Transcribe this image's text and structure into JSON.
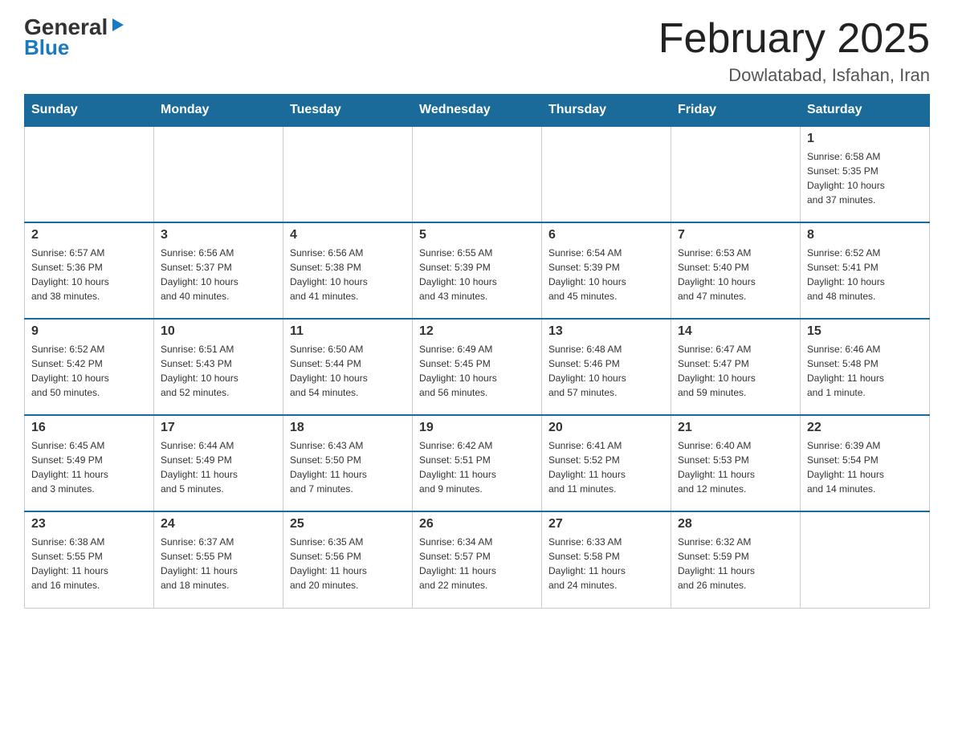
{
  "header": {
    "logo_general": "General",
    "logo_blue": "Blue",
    "month_title": "February 2025",
    "location": "Dowlatabad, Isfahan, Iran"
  },
  "days_of_week": [
    "Sunday",
    "Monday",
    "Tuesday",
    "Wednesday",
    "Thursday",
    "Friday",
    "Saturday"
  ],
  "weeks": [
    [
      {
        "day": "",
        "info": ""
      },
      {
        "day": "",
        "info": ""
      },
      {
        "day": "",
        "info": ""
      },
      {
        "day": "",
        "info": ""
      },
      {
        "day": "",
        "info": ""
      },
      {
        "day": "",
        "info": ""
      },
      {
        "day": "1",
        "info": "Sunrise: 6:58 AM\nSunset: 5:35 PM\nDaylight: 10 hours\nand 37 minutes."
      }
    ],
    [
      {
        "day": "2",
        "info": "Sunrise: 6:57 AM\nSunset: 5:36 PM\nDaylight: 10 hours\nand 38 minutes."
      },
      {
        "day": "3",
        "info": "Sunrise: 6:56 AM\nSunset: 5:37 PM\nDaylight: 10 hours\nand 40 minutes."
      },
      {
        "day": "4",
        "info": "Sunrise: 6:56 AM\nSunset: 5:38 PM\nDaylight: 10 hours\nand 41 minutes."
      },
      {
        "day": "5",
        "info": "Sunrise: 6:55 AM\nSunset: 5:39 PM\nDaylight: 10 hours\nand 43 minutes."
      },
      {
        "day": "6",
        "info": "Sunrise: 6:54 AM\nSunset: 5:39 PM\nDaylight: 10 hours\nand 45 minutes."
      },
      {
        "day": "7",
        "info": "Sunrise: 6:53 AM\nSunset: 5:40 PM\nDaylight: 10 hours\nand 47 minutes."
      },
      {
        "day": "8",
        "info": "Sunrise: 6:52 AM\nSunset: 5:41 PM\nDaylight: 10 hours\nand 48 minutes."
      }
    ],
    [
      {
        "day": "9",
        "info": "Sunrise: 6:52 AM\nSunset: 5:42 PM\nDaylight: 10 hours\nand 50 minutes."
      },
      {
        "day": "10",
        "info": "Sunrise: 6:51 AM\nSunset: 5:43 PM\nDaylight: 10 hours\nand 52 minutes."
      },
      {
        "day": "11",
        "info": "Sunrise: 6:50 AM\nSunset: 5:44 PM\nDaylight: 10 hours\nand 54 minutes."
      },
      {
        "day": "12",
        "info": "Sunrise: 6:49 AM\nSunset: 5:45 PM\nDaylight: 10 hours\nand 56 minutes."
      },
      {
        "day": "13",
        "info": "Sunrise: 6:48 AM\nSunset: 5:46 PM\nDaylight: 10 hours\nand 57 minutes."
      },
      {
        "day": "14",
        "info": "Sunrise: 6:47 AM\nSunset: 5:47 PM\nDaylight: 10 hours\nand 59 minutes."
      },
      {
        "day": "15",
        "info": "Sunrise: 6:46 AM\nSunset: 5:48 PM\nDaylight: 11 hours\nand 1 minute."
      }
    ],
    [
      {
        "day": "16",
        "info": "Sunrise: 6:45 AM\nSunset: 5:49 PM\nDaylight: 11 hours\nand 3 minutes."
      },
      {
        "day": "17",
        "info": "Sunrise: 6:44 AM\nSunset: 5:49 PM\nDaylight: 11 hours\nand 5 minutes."
      },
      {
        "day": "18",
        "info": "Sunrise: 6:43 AM\nSunset: 5:50 PM\nDaylight: 11 hours\nand 7 minutes."
      },
      {
        "day": "19",
        "info": "Sunrise: 6:42 AM\nSunset: 5:51 PM\nDaylight: 11 hours\nand 9 minutes."
      },
      {
        "day": "20",
        "info": "Sunrise: 6:41 AM\nSunset: 5:52 PM\nDaylight: 11 hours\nand 11 minutes."
      },
      {
        "day": "21",
        "info": "Sunrise: 6:40 AM\nSunset: 5:53 PM\nDaylight: 11 hours\nand 12 minutes."
      },
      {
        "day": "22",
        "info": "Sunrise: 6:39 AM\nSunset: 5:54 PM\nDaylight: 11 hours\nand 14 minutes."
      }
    ],
    [
      {
        "day": "23",
        "info": "Sunrise: 6:38 AM\nSunset: 5:55 PM\nDaylight: 11 hours\nand 16 minutes."
      },
      {
        "day": "24",
        "info": "Sunrise: 6:37 AM\nSunset: 5:55 PM\nDaylight: 11 hours\nand 18 minutes."
      },
      {
        "day": "25",
        "info": "Sunrise: 6:35 AM\nSunset: 5:56 PM\nDaylight: 11 hours\nand 20 minutes."
      },
      {
        "day": "26",
        "info": "Sunrise: 6:34 AM\nSunset: 5:57 PM\nDaylight: 11 hours\nand 22 minutes."
      },
      {
        "day": "27",
        "info": "Sunrise: 6:33 AM\nSunset: 5:58 PM\nDaylight: 11 hours\nand 24 minutes."
      },
      {
        "day": "28",
        "info": "Sunrise: 6:32 AM\nSunset: 5:59 PM\nDaylight: 11 hours\nand 26 minutes."
      },
      {
        "day": "",
        "info": ""
      }
    ]
  ]
}
